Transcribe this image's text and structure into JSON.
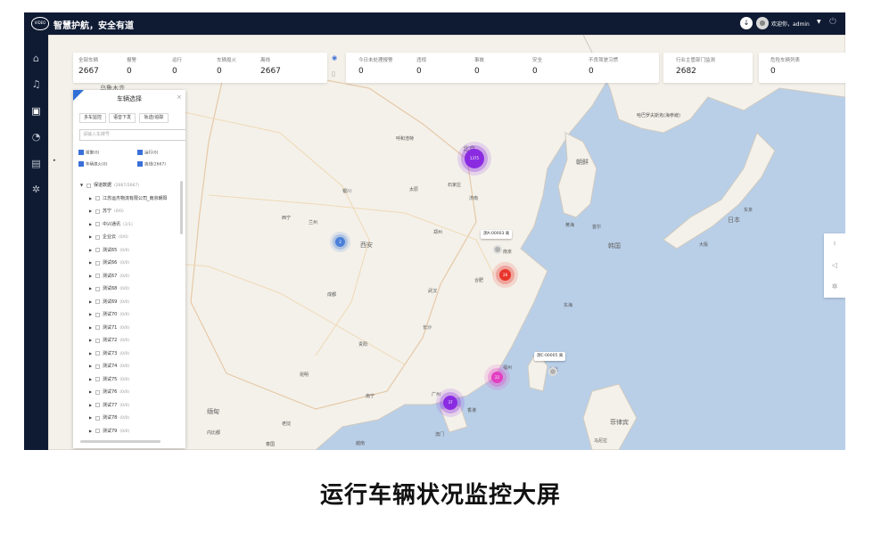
{
  "header": {
    "logo_text": "VIDEO",
    "title": "智慧护航，安全有道",
    "welcome": "欢迎你，admin",
    "dropdown_glyph": "▼",
    "icons": [
      "download-icon",
      "avatar-icon",
      "power-icon"
    ]
  },
  "sidebar": {
    "items": [
      "home-icon",
      "bell-icon",
      "monitor-icon",
      "chart-pie-icon",
      "report-icon",
      "settings-icon"
    ],
    "arrow_glyph": "▸"
  },
  "stats": {
    "group1": [
      {
        "label": "全部车辆",
        "value": "2667"
      },
      {
        "label": "报警",
        "value": "0"
      },
      {
        "label": "运行",
        "value": "0"
      },
      {
        "label": "车辆熄火",
        "value": "0"
      },
      {
        "label": "离线",
        "value": "2667"
      }
    ],
    "group2": [
      {
        "label": "今日未处理报警",
        "value": "0"
      },
      {
        "label": "违规",
        "value": "0"
      },
      {
        "label": "事故",
        "value": "0"
      },
      {
        "label": "安全",
        "value": "0"
      },
      {
        "label": "不良驾驶习惯",
        "value": "0"
      }
    ],
    "group3": {
      "label": "行业主管部门监测",
      "value": "2682"
    },
    "group4": {
      "label": "危险车辆列表",
      "value": "0"
    }
  },
  "vehicle_panel": {
    "title": "车辆选择",
    "close": "×",
    "tabs": [
      "多车监控",
      "语音下发",
      "轨迹/追踪"
    ],
    "search_placeholder": "请输入车牌号",
    "filters": [
      "报警(0)",
      "运行(0)",
      "车辆熄火(0)",
      "离线(2667)"
    ],
    "tree": [
      {
        "label": "保道数据",
        "count": "(2667/2667)",
        "root": true
      },
      {
        "label": "江苏运杰物流有限公司_南京朝阳",
        "count": ""
      },
      {
        "label": "苏宁",
        "count": "(0/0)"
      },
      {
        "label": "中兴通讯",
        "count": "(1/1)"
      },
      {
        "label": "企业云",
        "count": "(0/0)"
      },
      {
        "label": "测试65",
        "count": "(0/0)"
      },
      {
        "label": "测试66",
        "count": "(0/0)"
      },
      {
        "label": "测试67",
        "count": "(0/0)"
      },
      {
        "label": "测试68",
        "count": "(0/0)"
      },
      {
        "label": "测试69",
        "count": "(0/0)"
      },
      {
        "label": "测试70",
        "count": "(0/0)"
      },
      {
        "label": "测试71",
        "count": "(0/0)"
      },
      {
        "label": "测试72",
        "count": "(0/0)"
      },
      {
        "label": "测试73",
        "count": "(0/0)"
      },
      {
        "label": "测试74",
        "count": "(0/0)"
      },
      {
        "label": "测试75",
        "count": "(0/0)"
      },
      {
        "label": "测试76",
        "count": "(0/0)"
      },
      {
        "label": "测试77",
        "count": "(0/0)"
      },
      {
        "label": "测试78",
        "count": "(0/0)"
      },
      {
        "label": "测试79",
        "count": "(0/0)"
      }
    ]
  },
  "map": {
    "labels": [
      "乌鲁木齐",
      "呼和浩特",
      "北京",
      "石家庄",
      "太原",
      "济南",
      "银川",
      "西宁",
      "兰州",
      "西安",
      "郑州",
      "南京",
      "合肥",
      "成都",
      "武汉",
      "长沙",
      "贵阳",
      "昆明",
      "南宁",
      "广州",
      "香港",
      "澳门",
      "福州",
      "台北",
      "新疆",
      "朝鲜",
      "韩国",
      "首尔",
      "日本",
      "东京",
      "大阪",
      "缅甸",
      "内比都",
      "老挝",
      "越南",
      "菲律宾",
      "马尼拉",
      "泰国",
      "东海",
      "黄海",
      "哈巴罗夫斯克(海参崴)"
    ],
    "callouts": [
      "测A·00003 离",
      "测C·00005 离"
    ],
    "clusters": [
      {
        "value": "1375",
        "color": "#8a2be2"
      },
      {
        "value": "2",
        "color": "#4a7fd8"
      },
      {
        "value": "28",
        "color": "#e8352b"
      },
      {
        "value": "22",
        "color": "#e23fc2"
      },
      {
        "value": "37",
        "color": "#8a2be2"
      }
    ]
  },
  "right_tools": [
    "alarm-bell-icon",
    "speaker-icon",
    "gear-icon"
  ],
  "caption": "运行车辆状况监控大屏"
}
